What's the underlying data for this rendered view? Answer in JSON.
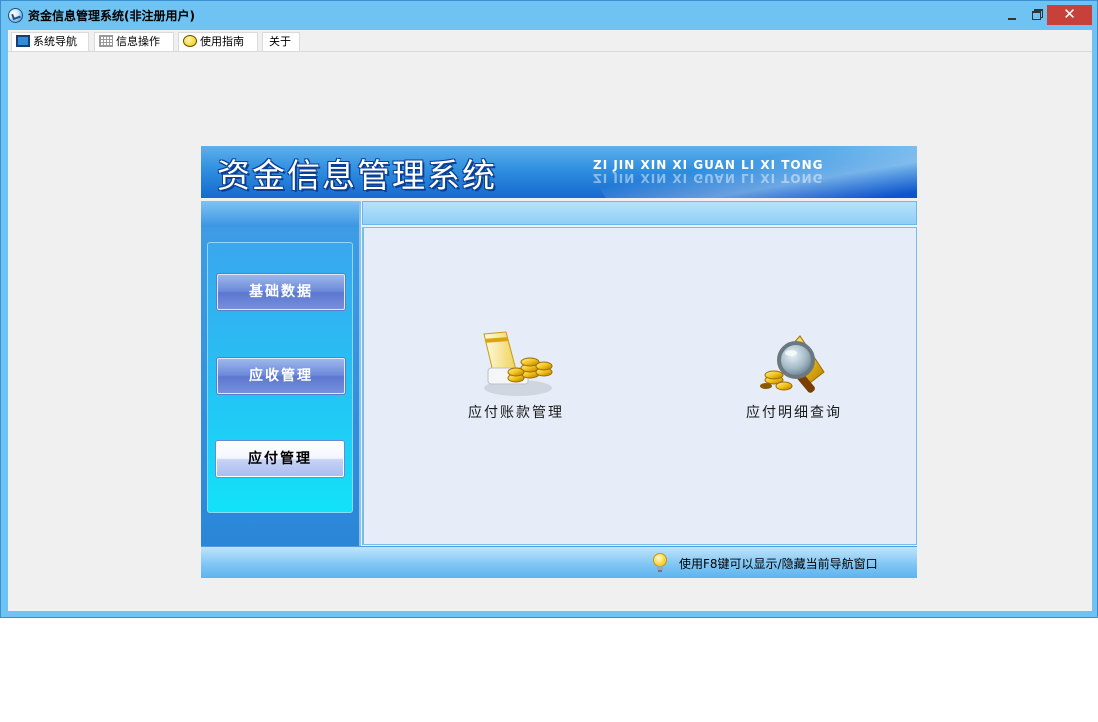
{
  "window": {
    "title": "资金信息管理系统(非注册用户)",
    "close_glyph": "✕"
  },
  "tabs": [
    {
      "label": "系统导航",
      "icon": "monitor-icon"
    },
    {
      "label": "信息操作",
      "icon": "grid-icon"
    },
    {
      "label": "使用指南",
      "icon": "help-icon"
    },
    {
      "label": "关于",
      "icon": ""
    }
  ],
  "banner": {
    "title": "资金信息管理系统",
    "pinyin": "ZI JIN XIN XI GUAN LI XI TONG"
  },
  "sidebar": {
    "items": [
      {
        "label": "基础数据",
        "state": "normal"
      },
      {
        "label": "应收管理",
        "state": "normal"
      },
      {
        "label": "应付管理",
        "state": "active"
      }
    ]
  },
  "content": {
    "features": [
      {
        "label": "应付账款管理",
        "icon": "payables-coins-icon"
      },
      {
        "label": "应付明细查询",
        "icon": "detail-search-icon"
      }
    ]
  },
  "status": {
    "hint": "使用F8键可以显示/隐藏当前导航窗口",
    "icon": "lightbulb-icon"
  },
  "colors": {
    "window_frame": "#6ec3f2",
    "close_button": "#c7403a",
    "banner": "#1669cf",
    "content_bg": "#e6edf8"
  }
}
